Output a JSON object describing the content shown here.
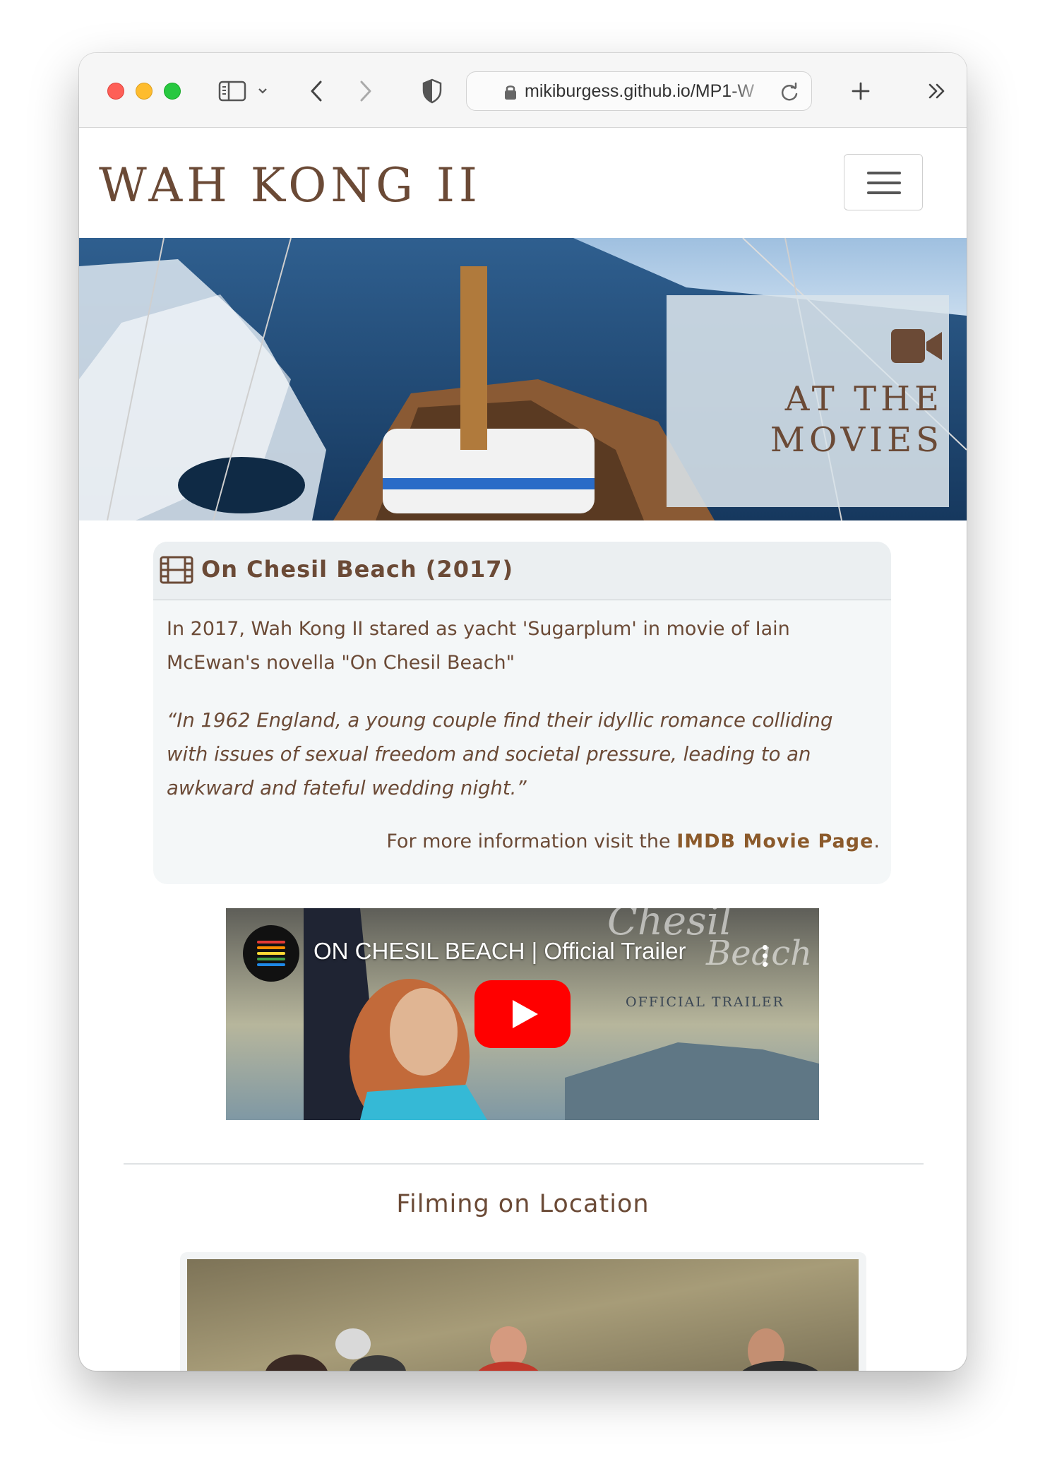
{
  "browser": {
    "url": "mikiburgess.github.io/MP1-W",
    "icons": {
      "sidebar": "sidebar-icon",
      "chevron": "chevron-down-icon",
      "back": "chevron-left-icon",
      "forward": "chevron-right-icon",
      "privacy": "shield-icon",
      "lock": "lock-icon",
      "reload": "reload-icon",
      "new_tab": "plus-icon",
      "overflow": "double-chevron-right-icon"
    }
  },
  "header": {
    "brand": "WAH KONG II",
    "menu_icon": "hamburger-icon"
  },
  "hero": {
    "icon": "video-camera-icon",
    "title_line1": "AT THE",
    "title_line2": "MOVIES"
  },
  "card": {
    "icon": "film-icon",
    "title": "On Chesil Beach (2017)",
    "description": "In 2017, Wah Kong II stared as yacht 'Sugarplum' in movie of Iain McEwan's novella \"On Chesil Beach\"",
    "quote": "“In 1962 England, a young couple find their idyllic romance colliding with issues of sexual freedom and societal pressure, leading to an awkward and fateful wedding night.”",
    "link_prefix": "For more information visit the ",
    "link_text": "IMDB Movie Page",
    "link_suffix": "."
  },
  "video": {
    "title": "ON CHESIL BEACH | Official Trailer",
    "caption": "OFFICIAL TRAILER",
    "script_word1": "Chesil",
    "script_word2": "Beach",
    "play_icon": "youtube-play-icon",
    "menu_icon": "more-vertical-icon"
  },
  "section": {
    "title": "Filming on Location"
  },
  "colors": {
    "brand_brown": "#6b4a36",
    "link_brown": "#8b5a2b",
    "card_bg": "#f4f7f8",
    "youtube_red": "#ff0000"
  }
}
